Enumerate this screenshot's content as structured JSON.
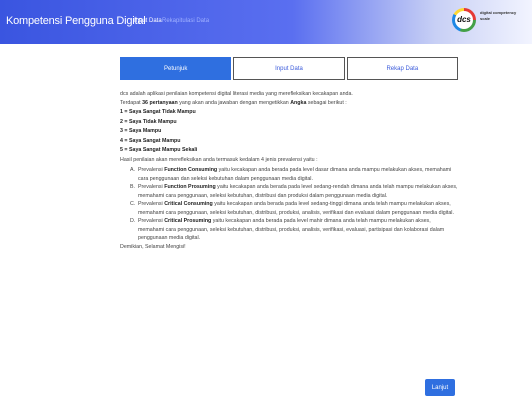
{
  "header": {
    "brand": "Kompetensi Pengguna Digital",
    "nav": [
      "Input Data",
      "Rekapitulasi Data"
    ],
    "logo": {
      "mark": "dcs",
      "text": "digital competency scale"
    }
  },
  "tabs": [
    "Petunjuk",
    "Input Data",
    "Rekap Data"
  ],
  "content": {
    "intro": "dcs adalah aplikasi penilaian kompetensi digital literasi media yang merefleksikan kecakapan anda.",
    "intro2": {
      "pre": "Terdapat ",
      "count": "36 pertanyaan",
      "mid": " yang akan anda jawaban dengan mengetikkan ",
      "kw": "Angka",
      "post": " sebagai berikut :"
    },
    "scale": [
      "1 = Saya Sangat Tidak Mampu",
      "2 = Saya Tidak Mampu",
      "3 = Saya Mampu",
      "4 = Saya Sangat Mampu",
      "5 = Saya Sangat Mampu Sekali"
    ],
    "intro3": "Hasil penilaian akan merefleksikan anda termasuk kedalam 4 jenis prevalensi yaitu :",
    "levels": [
      {
        "letter": "A.",
        "pre": "Prevalensi ",
        "name": "Function Consuming",
        "desc": " yaitu kecakapan anda berada pada level dasar dimana anda mampu melakukan akses, memahami cara penggunaan dan seleksi kebutuhan dalam penggunaan media digital."
      },
      {
        "letter": "B.",
        "pre": "Prevalensi ",
        "name": "Function Prosuming",
        "desc": " yaitu kecakapan anda berada pada level sedang-rendah dimana anda telah mampu melakukan akses, memahami cara penggunaan, seleksi kebutuhan, distribusi dan produksi dalam penggunaan media digital."
      },
      {
        "letter": "C.",
        "pre": "Prevalensi ",
        "name": "Critical Consuming",
        "desc": " yaitu kecakapan anda berada pada level sedang-tinggi dimana anda telah mampu melakukan akses, memahami cara penggunaan, seleksi kebutuhan, distribusi, produksi, analisis, verifikasi dan evaluasi dalam penggunaan media digital."
      },
      {
        "letter": "D.",
        "pre": "Prevalensi ",
        "name": "Critical Prosuming",
        "desc": " yaitu kecakapan anda berada pada level mahir dimana anda telah mampu melakukan akses, memahami cara penggunaan, seleksi kebutuhan, distribusi, produksi, analisis, verifikasi, evaluasi, partisipasi dan kolaborasi dalam penggunaan media digital."
      }
    ],
    "closing": "Demikian, Selamat Mengisi!"
  },
  "next_button": "Lanjut",
  "colors": {
    "primary": "#2f6fe0",
    "navbar_start": "#3a55e0"
  }
}
